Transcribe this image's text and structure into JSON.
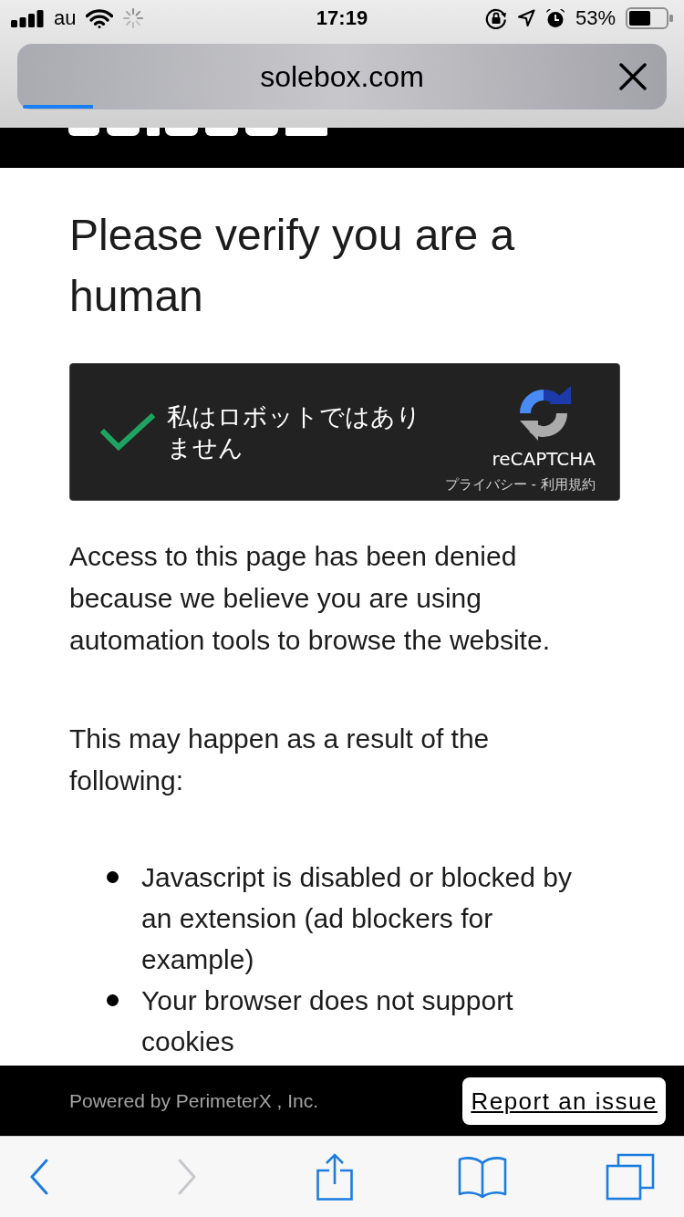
{
  "status_bar": {
    "carrier": "au",
    "time": "17:19",
    "battery_percent": "53%"
  },
  "address_bar": {
    "url": "solebox.com",
    "progress": {
      "level": 0.11
    }
  },
  "page": {
    "heading": "Please verify you are a human",
    "captcha": {
      "checked": true,
      "label": "私はロボットではありません",
      "brand": "reCAPTCHA",
      "privacy_link": "プライバシー",
      "separator": "-",
      "terms_link": "利用規約"
    },
    "paragraphs": [
      "Access to this page has been denied because we believe you are using automation tools to browse the website.",
      "This may happen as a result of the following:"
    ],
    "reasons": [
      "Javascript is disabled or blocked by an extension (ad blockers for example)",
      "Your browser does not support cookies"
    ]
  },
  "footer": {
    "powered_by": "Powered by PerimeterX , Inc.",
    "report_button": "Report an issue"
  },
  "toolbar": [
    {
      "kind": "back",
      "disabled": false
    },
    {
      "kind": "forward",
      "disabled": true
    },
    {
      "kind": "share",
      "disabled": false
    },
    {
      "kind": "bookmarks",
      "disabled": false
    },
    {
      "kind": "tabs",
      "disabled": false
    }
  ]
}
